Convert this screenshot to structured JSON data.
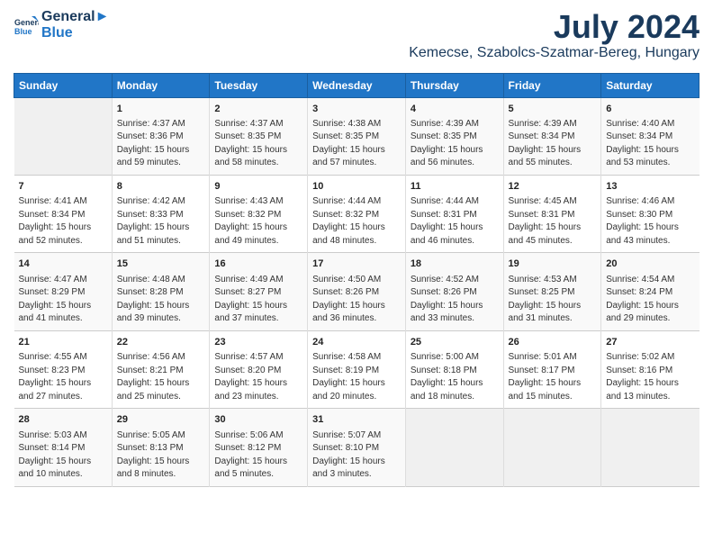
{
  "header": {
    "logo_line1": "General",
    "logo_line2": "Blue",
    "month_title": "July 2024",
    "location": "Kemecse, Szabolcs-Szatmar-Bereg, Hungary"
  },
  "columns": [
    "Sunday",
    "Monday",
    "Tuesday",
    "Wednesday",
    "Thursday",
    "Friday",
    "Saturday"
  ],
  "weeks": [
    {
      "days": [
        {
          "num": "",
          "detail": ""
        },
        {
          "num": "1",
          "detail": "Sunrise: 4:37 AM\nSunset: 8:36 PM\nDaylight: 15 hours\nand 59 minutes."
        },
        {
          "num": "2",
          "detail": "Sunrise: 4:37 AM\nSunset: 8:35 PM\nDaylight: 15 hours\nand 58 minutes."
        },
        {
          "num": "3",
          "detail": "Sunrise: 4:38 AM\nSunset: 8:35 PM\nDaylight: 15 hours\nand 57 minutes."
        },
        {
          "num": "4",
          "detail": "Sunrise: 4:39 AM\nSunset: 8:35 PM\nDaylight: 15 hours\nand 56 minutes."
        },
        {
          "num": "5",
          "detail": "Sunrise: 4:39 AM\nSunset: 8:34 PM\nDaylight: 15 hours\nand 55 minutes."
        },
        {
          "num": "6",
          "detail": "Sunrise: 4:40 AM\nSunset: 8:34 PM\nDaylight: 15 hours\nand 53 minutes."
        }
      ]
    },
    {
      "days": [
        {
          "num": "7",
          "detail": "Sunrise: 4:41 AM\nSunset: 8:34 PM\nDaylight: 15 hours\nand 52 minutes."
        },
        {
          "num": "8",
          "detail": "Sunrise: 4:42 AM\nSunset: 8:33 PM\nDaylight: 15 hours\nand 51 minutes."
        },
        {
          "num": "9",
          "detail": "Sunrise: 4:43 AM\nSunset: 8:32 PM\nDaylight: 15 hours\nand 49 minutes."
        },
        {
          "num": "10",
          "detail": "Sunrise: 4:44 AM\nSunset: 8:32 PM\nDaylight: 15 hours\nand 48 minutes."
        },
        {
          "num": "11",
          "detail": "Sunrise: 4:44 AM\nSunset: 8:31 PM\nDaylight: 15 hours\nand 46 minutes."
        },
        {
          "num": "12",
          "detail": "Sunrise: 4:45 AM\nSunset: 8:31 PM\nDaylight: 15 hours\nand 45 minutes."
        },
        {
          "num": "13",
          "detail": "Sunrise: 4:46 AM\nSunset: 8:30 PM\nDaylight: 15 hours\nand 43 minutes."
        }
      ]
    },
    {
      "days": [
        {
          "num": "14",
          "detail": "Sunrise: 4:47 AM\nSunset: 8:29 PM\nDaylight: 15 hours\nand 41 minutes."
        },
        {
          "num": "15",
          "detail": "Sunrise: 4:48 AM\nSunset: 8:28 PM\nDaylight: 15 hours\nand 39 minutes."
        },
        {
          "num": "16",
          "detail": "Sunrise: 4:49 AM\nSunset: 8:27 PM\nDaylight: 15 hours\nand 37 minutes."
        },
        {
          "num": "17",
          "detail": "Sunrise: 4:50 AM\nSunset: 8:26 PM\nDaylight: 15 hours\nand 36 minutes."
        },
        {
          "num": "18",
          "detail": "Sunrise: 4:52 AM\nSunset: 8:26 PM\nDaylight: 15 hours\nand 33 minutes."
        },
        {
          "num": "19",
          "detail": "Sunrise: 4:53 AM\nSunset: 8:25 PM\nDaylight: 15 hours\nand 31 minutes."
        },
        {
          "num": "20",
          "detail": "Sunrise: 4:54 AM\nSunset: 8:24 PM\nDaylight: 15 hours\nand 29 minutes."
        }
      ]
    },
    {
      "days": [
        {
          "num": "21",
          "detail": "Sunrise: 4:55 AM\nSunset: 8:23 PM\nDaylight: 15 hours\nand 27 minutes."
        },
        {
          "num": "22",
          "detail": "Sunrise: 4:56 AM\nSunset: 8:21 PM\nDaylight: 15 hours\nand 25 minutes."
        },
        {
          "num": "23",
          "detail": "Sunrise: 4:57 AM\nSunset: 8:20 PM\nDaylight: 15 hours\nand 23 minutes."
        },
        {
          "num": "24",
          "detail": "Sunrise: 4:58 AM\nSunset: 8:19 PM\nDaylight: 15 hours\nand 20 minutes."
        },
        {
          "num": "25",
          "detail": "Sunrise: 5:00 AM\nSunset: 8:18 PM\nDaylight: 15 hours\nand 18 minutes."
        },
        {
          "num": "26",
          "detail": "Sunrise: 5:01 AM\nSunset: 8:17 PM\nDaylight: 15 hours\nand 15 minutes."
        },
        {
          "num": "27",
          "detail": "Sunrise: 5:02 AM\nSunset: 8:16 PM\nDaylight: 15 hours\nand 13 minutes."
        }
      ]
    },
    {
      "days": [
        {
          "num": "28",
          "detail": "Sunrise: 5:03 AM\nSunset: 8:14 PM\nDaylight: 15 hours\nand 10 minutes."
        },
        {
          "num": "29",
          "detail": "Sunrise: 5:05 AM\nSunset: 8:13 PM\nDaylight: 15 hours\nand 8 minutes."
        },
        {
          "num": "30",
          "detail": "Sunrise: 5:06 AM\nSunset: 8:12 PM\nDaylight: 15 hours\nand 5 minutes."
        },
        {
          "num": "31",
          "detail": "Sunrise: 5:07 AM\nSunset: 8:10 PM\nDaylight: 15 hours\nand 3 minutes."
        },
        {
          "num": "",
          "detail": ""
        },
        {
          "num": "",
          "detail": ""
        },
        {
          "num": "",
          "detail": ""
        }
      ]
    }
  ]
}
